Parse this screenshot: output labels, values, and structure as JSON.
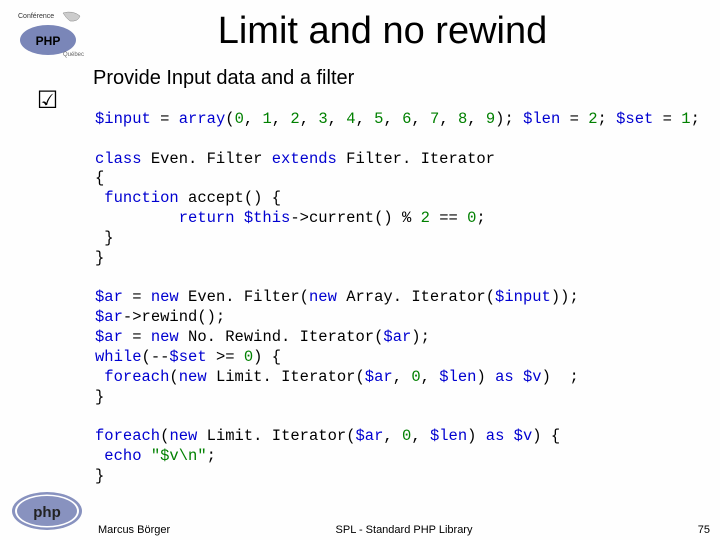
{
  "title": "Limit and no rewind",
  "subtitle": "Provide Input data and a filter",
  "code": {
    "l1a": "$input ",
    "l1b": "= ",
    "l1c": "array",
    "l1d": "(",
    "l1e": "0",
    "l1f": ", ",
    "l1g": "1",
    "l1h": ", ",
    "l1i": "2",
    "l1j": ", ",
    "l1k": "3",
    "l1l": ", ",
    "l1m": "4",
    "l1n": ", ",
    "l1o": "5",
    "l1p": ", ",
    "l1q": "6",
    "l1r": ", ",
    "l1s": "7",
    "l1t": ", ",
    "l1u": "8",
    "l1v": ", ",
    "l1w": "9",
    "l1x": "); ",
    "l1y": "$len ",
    "l1z": "= ",
    "l1aa": "2",
    "l1ab": "; ",
    "l1ac": "$set ",
    "l1ad": "= ",
    "l1ae": "1",
    "l1af": ";",
    "l2a": "class ",
    "l2b": "Even. Filter ",
    "l2c": "extends ",
    "l2d": "Filter. Iterator",
    "l3": "{",
    "l4a": " function ",
    "l4b": "accept",
    "l4c": "() {",
    "l5a": "         return ",
    "l5b": "$this",
    "l5c": "->",
    "l5d": "current",
    "l5e": "() % ",
    "l5f": "2 ",
    "l5g": "== ",
    "l5h": "0",
    "l5i": ";",
    "l6": " }",
    "l7": "}",
    "l8a": "$ar ",
    "l8b": "= ",
    "l8c": "new ",
    "l8d": "Even. Filter",
    "l8e": "(",
    "l8f": "new ",
    "l8g": "Array. Iterator",
    "l8h": "(",
    "l8i": "$input",
    "l8j": "));",
    "l9a": "$ar",
    "l9b": "->",
    "l9c": "rewind",
    "l9d": "();",
    "l10a": "$ar ",
    "l10b": "= ",
    "l10c": "new ",
    "l10d": "No. Rewind. Iterator",
    "l10e": "(",
    "l10f": "$ar",
    "l10g": ");",
    "l11a": "while",
    "l11b": "(--",
    "l11c": "$set ",
    "l11d": ">= ",
    "l11e": "0",
    "l11f": ") {",
    "l12a": " foreach",
    "l12b": "(",
    "l12c": "new ",
    "l12d": "Limit. Iterator",
    "l12e": "(",
    "l12f": "$ar",
    "l12g": ", ",
    "l12h": "0",
    "l12i": ", ",
    "l12j": "$len",
    "l12k": ") ",
    "l12l": "as ",
    "l12m": "$v",
    "l12n": ")  ;",
    "l13": "}",
    "l14a": "foreach",
    "l14b": "(",
    "l14c": "new ",
    "l14d": "Limit. Iterator",
    "l14e": "(",
    "l14f": "$ar",
    "l14g": ", ",
    "l14h": "0",
    "l14i": ", ",
    "l14j": "$len",
    "l14k": ") ",
    "l14l": "as ",
    "l14m": "$v",
    "l14n": ") {",
    "l15a": " echo ",
    "l15b": "\"$v\\n\"",
    "l15c": ";",
    "l16": "}"
  },
  "footer": {
    "author": "Marcus Börger",
    "center": "SPL - Standard PHP Library",
    "page": "75"
  }
}
